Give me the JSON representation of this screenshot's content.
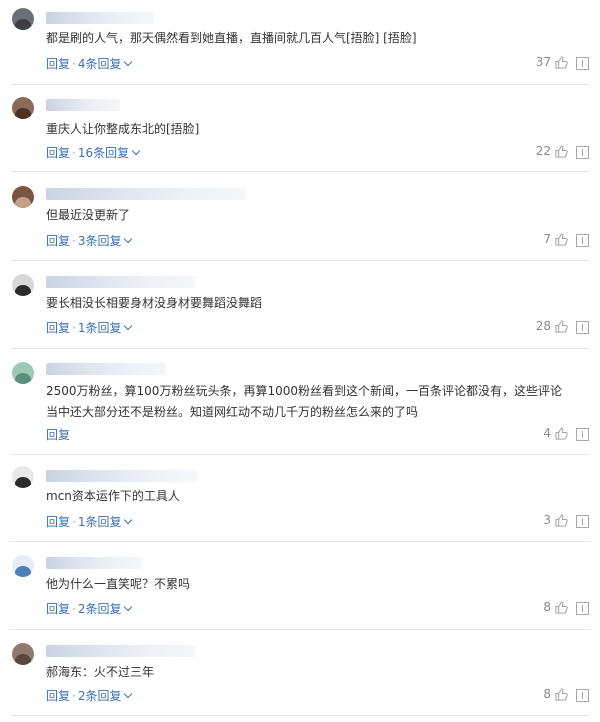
{
  "comments": [
    {
      "text": "都是刷的人气，那天偶然看到她直播，直播间就几百人气[捂脸] [捂脸]",
      "reply": "回复",
      "more": "4条回复",
      "likes": "37",
      "avatar_bg": "#6b7076",
      "avatar_fg": "#3d3f44"
    },
    {
      "text": "重庆人让你整成东北的[捂脸]",
      "reply": "回复",
      "more": "16条回复",
      "likes": "22",
      "avatar_bg": "#8a6a58",
      "avatar_fg": "#4a3226"
    },
    {
      "text": "但最近没更新了",
      "reply": "回复",
      "more": "3条回复",
      "likes": "7",
      "avatar_bg": "#7a5542",
      "avatar_fg": "#c3a08c"
    },
    {
      "text": "要长相没长相要身材没身材要舞蹈没舞蹈",
      "reply": "回复",
      "more": "1条回复",
      "likes": "28",
      "avatar_bg": "#d9d9d9",
      "avatar_fg": "#2c2c2c"
    },
    {
      "text": "2500万粉丝，算100万粉丝玩头条，再算1000粉丝看到这个新闻，一百条评论都没有，这些评论当中还大部分还不是粉丝。知道网红动不动几千万的粉丝怎么来的了吗",
      "reply": "回复",
      "more": "",
      "likes": "4",
      "avatar_bg": "#9fc9b7",
      "avatar_fg": "#5a8f7c"
    },
    {
      "text": "mcn资本运作下的工具人",
      "reply": "回复",
      "more": "1条回复",
      "likes": "3",
      "avatar_bg": "#e9e9e9",
      "avatar_fg": "#2c2c2c"
    },
    {
      "text": "他为什么一直笑呢？不累吗",
      "reply": "回复",
      "more": "2条回复",
      "likes": "8",
      "avatar_bg": "#e6edf6",
      "avatar_fg": "#4d7fb8"
    },
    {
      "text": "郝海东：火不过三年",
      "reply": "回复",
      "more": "2条回复",
      "likes": "8",
      "avatar_bg": "#8f7a70",
      "avatar_fg": "#5a463d"
    }
  ]
}
